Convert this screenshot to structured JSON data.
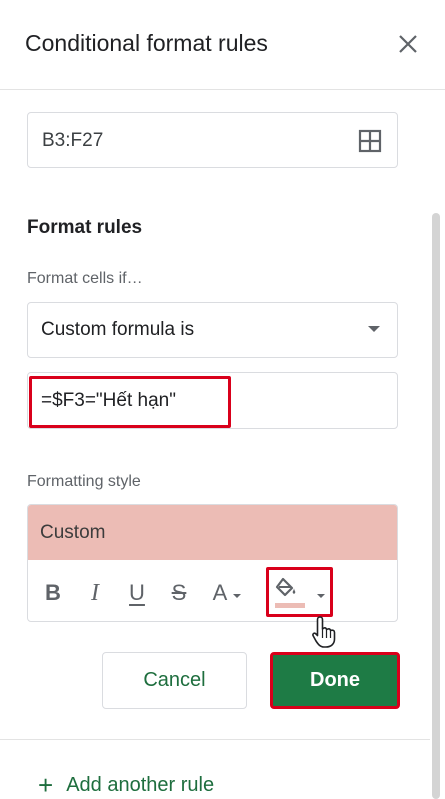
{
  "panel": {
    "title": "Conditional format rules",
    "close_icon": "close-icon"
  },
  "range": {
    "value": "B3:F27",
    "icon": "grid-select-icon"
  },
  "format_rules": {
    "heading": "Format rules",
    "condition_label": "Format cells if…",
    "condition_value": "Custom formula is",
    "formula_value": "=$F3=\"Hết hạn\""
  },
  "formatting_style": {
    "label": "Formatting style",
    "preview_text": "Custom",
    "preview_color": "#ecbcb5",
    "toolbar": {
      "bold": "B",
      "italic": "I",
      "underline": "U",
      "strikethrough": "S",
      "text_color": "A",
      "fill_icon": "fill-color-icon"
    }
  },
  "actions": {
    "cancel_label": "Cancel",
    "done_label": "Done",
    "add_rule_label": "Add another rule"
  },
  "colors": {
    "accent": "#1e7b45",
    "highlight": "#d9001b"
  }
}
